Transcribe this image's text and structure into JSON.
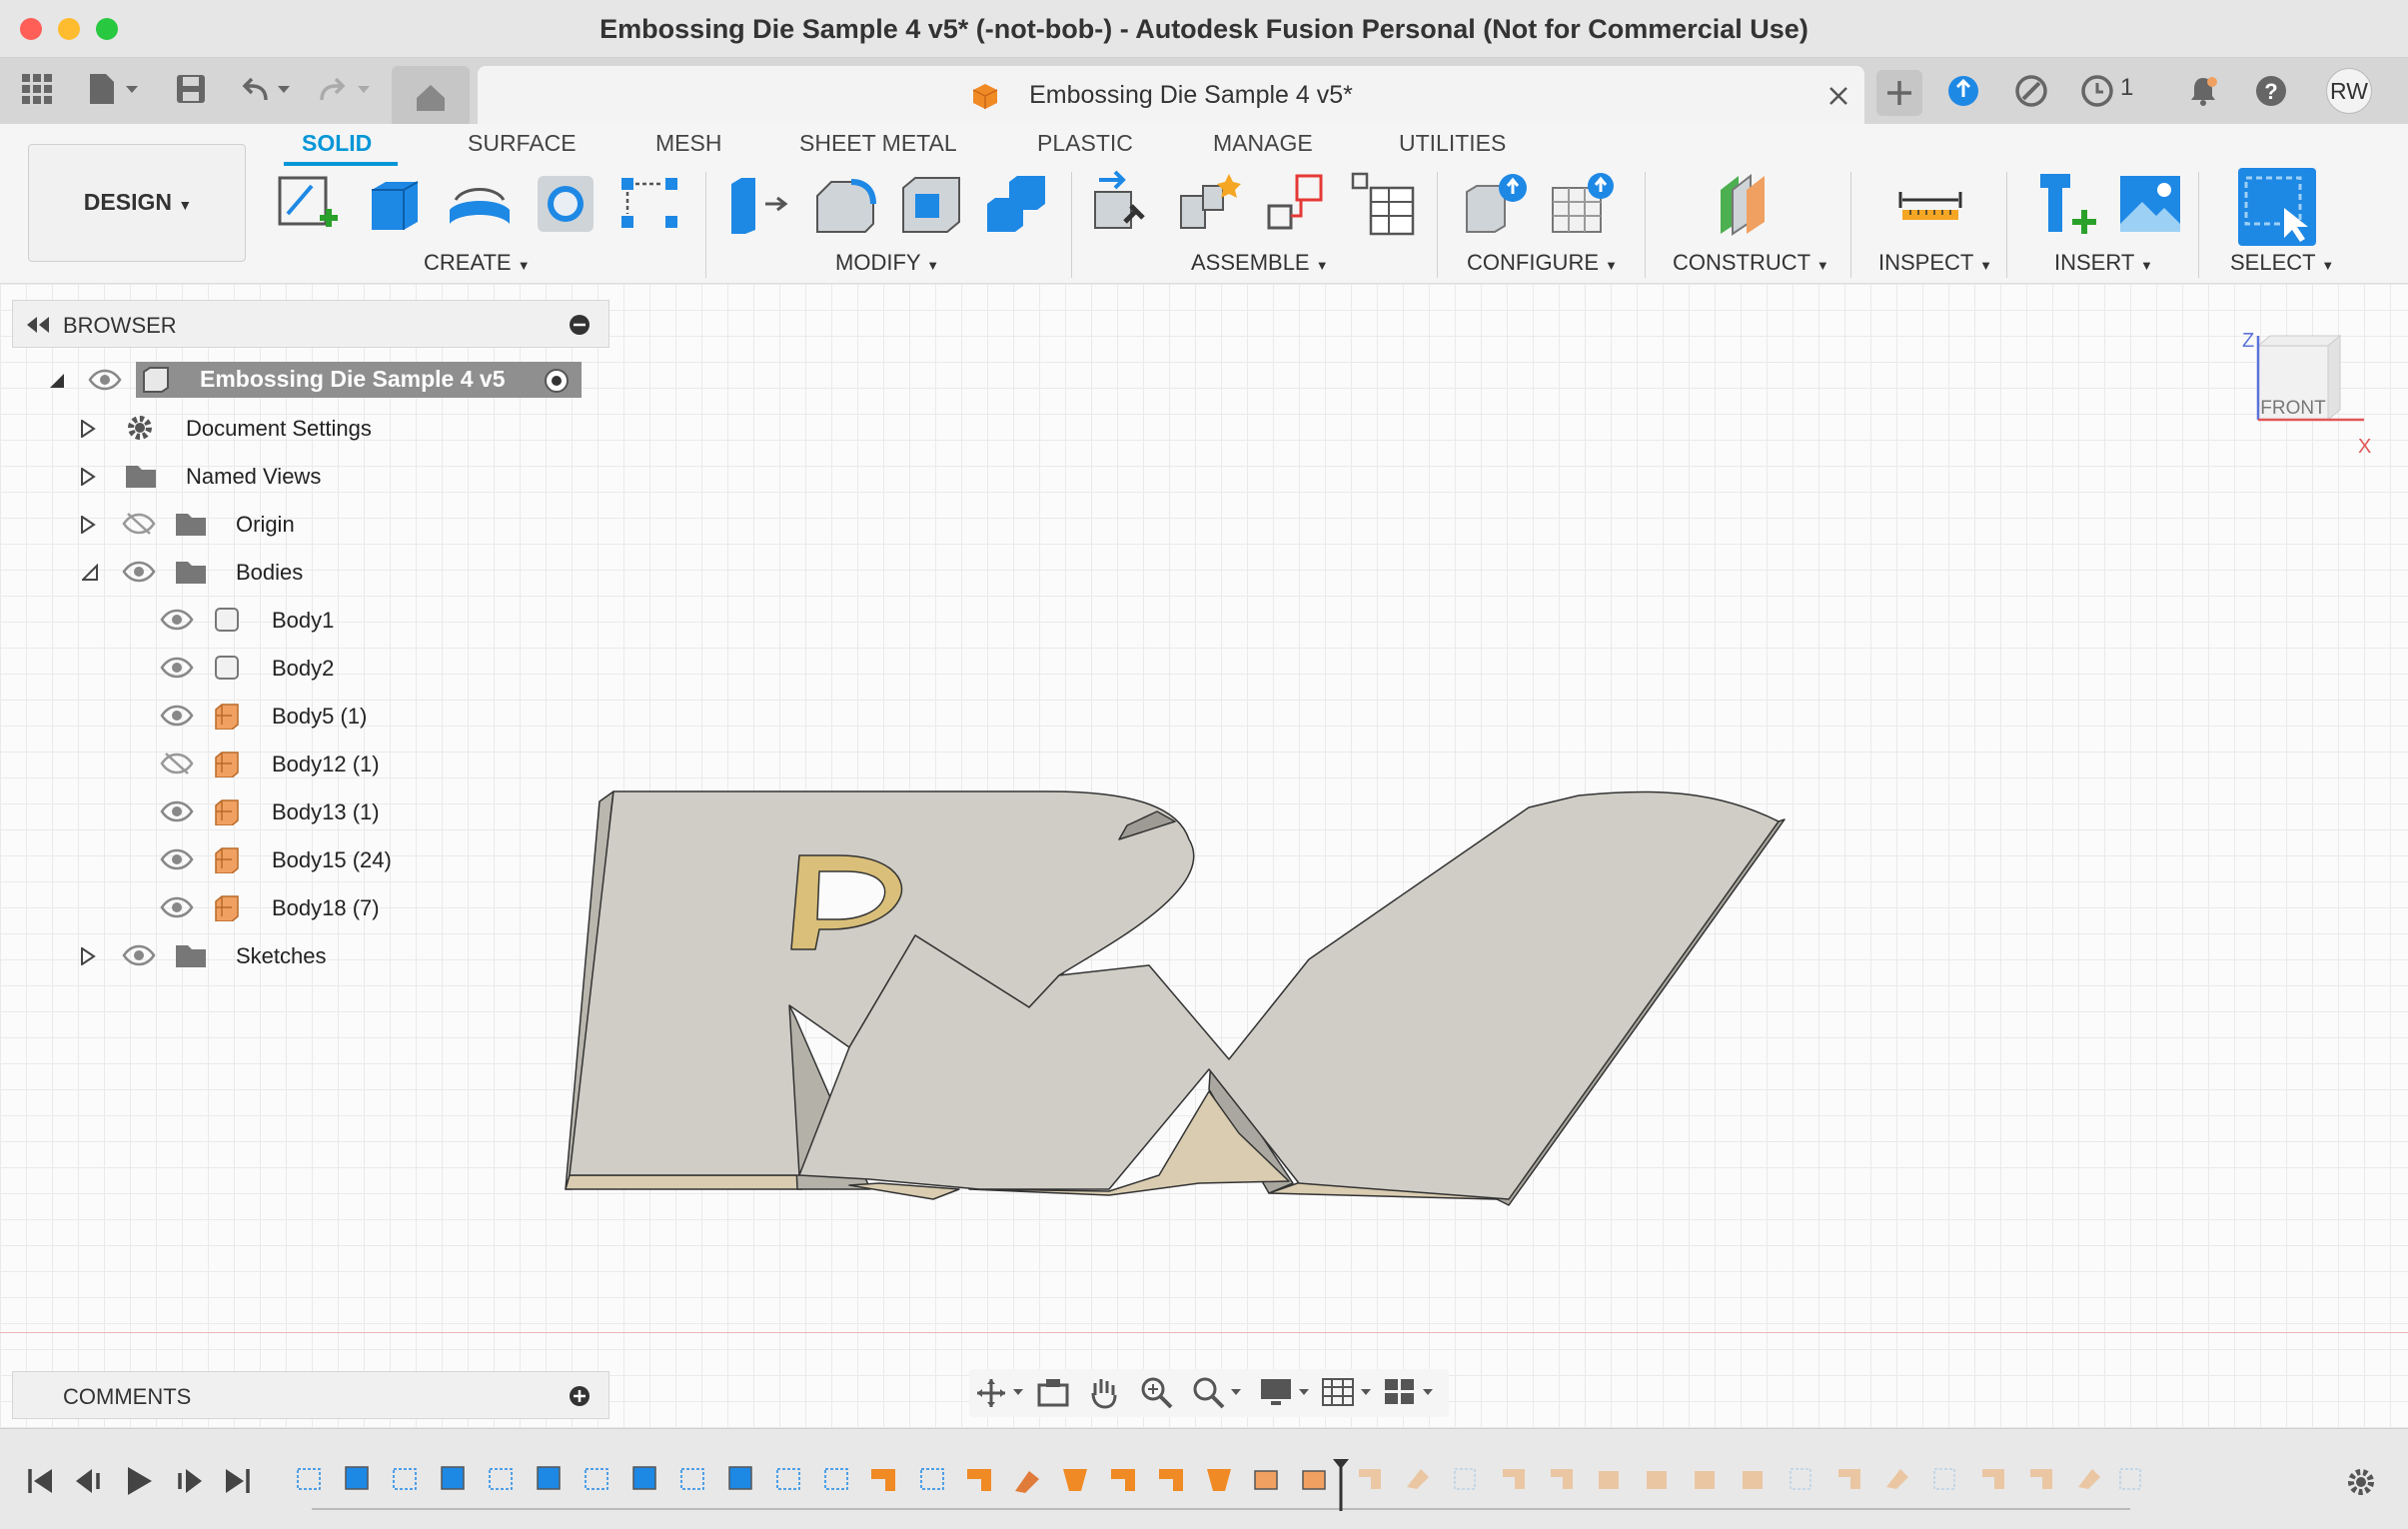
{
  "window": {
    "title": "Embossing Die Sample 4 v5* (-not-bob-) - Autodesk Fusion Personal (Not for Commercial Use)"
  },
  "tabs": {
    "doc_title": "Embossing Die Sample 4 v5*",
    "jobs_count": "1",
    "user_initials": "RW"
  },
  "workspace": {
    "label": "DESIGN"
  },
  "ribbon": {
    "tabs": [
      "SOLID",
      "SURFACE",
      "MESH",
      "SHEET METAL",
      "PLASTIC",
      "MANAGE",
      "UTILITIES"
    ],
    "active_tab": "SOLID",
    "groups": [
      "CREATE",
      "MODIFY",
      "ASSEMBLE",
      "CONFIGURE",
      "CONSTRUCT",
      "INSPECT",
      "INSERT",
      "SELECT"
    ]
  },
  "browser": {
    "title": "BROWSER",
    "root": "Embossing Die Sample 4 v5",
    "items": [
      "Document Settings",
      "Named Views",
      "Origin",
      "Bodies"
    ],
    "bodies": [
      "Body1",
      "Body2",
      "Body5 (1)",
      "Body12 (1)",
      "Body13 (1)",
      "Body15 (24)",
      "Body18 (7)"
    ],
    "sketches": "Sketches"
  },
  "viewcube": {
    "face": "FRONT",
    "axis_z": "Z",
    "axis_x": "X"
  },
  "comments": {
    "title": "COMMENTS"
  },
  "colors": {
    "accent": "#0696d7",
    "body": "#cfcdc5",
    "body_orange": "#f0a060",
    "titlebar": "#e6e6e6"
  }
}
